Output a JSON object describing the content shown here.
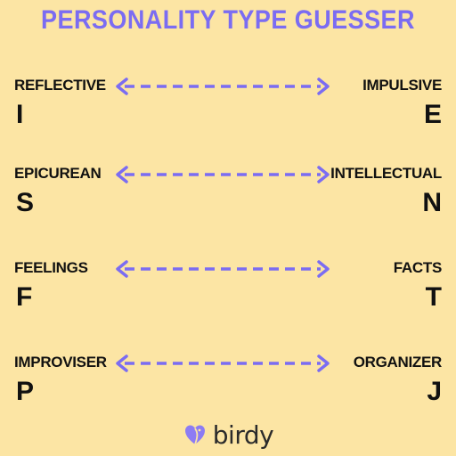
{
  "title": "PERSONALITY TYPE GUESSER",
  "accent_color": "#7b6cf2",
  "pairs": [
    {
      "left_label": "REFLECTIVE",
      "left_letter": "I",
      "right_label": "IMPULSIVE",
      "right_letter": "E"
    },
    {
      "left_label": "EPICUREAN",
      "left_letter": "S",
      "right_label": "INTELLECTUAL",
      "right_letter": "N"
    },
    {
      "left_label": "FEELINGS",
      "left_letter": "F",
      "right_label": "FACTS",
      "right_letter": "T"
    },
    {
      "left_label": "IMPROVISER",
      "left_letter": "P",
      "right_label": "ORGANIZER",
      "right_letter": "J"
    }
  ],
  "logo": {
    "text": "birdy",
    "icon": "bird-heart-icon"
  }
}
